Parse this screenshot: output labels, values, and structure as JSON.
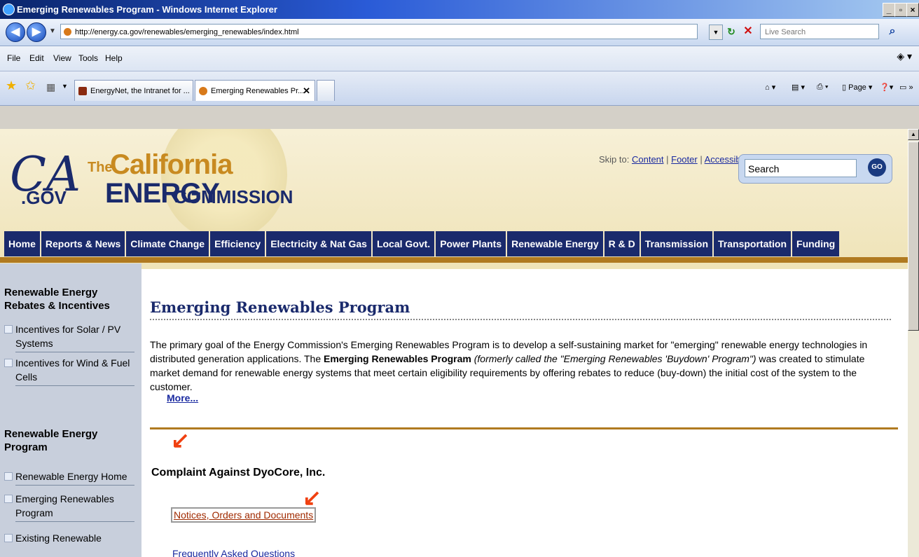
{
  "window": {
    "title": "Emerging Renewables Program - Windows Internet Explorer",
    "minimize": "_",
    "maximize": "▫",
    "close": "×"
  },
  "toolbar": {
    "url": "http://energy.ca.gov/renewables/emerging_renewables/index.html",
    "search_placeholder": "Live Search"
  },
  "menu": {
    "items": [
      "File",
      "Edit",
      "View",
      "Tools",
      "Help"
    ]
  },
  "tabs": [
    {
      "label": "EnergyNet, the Intranet for ..."
    },
    {
      "label": "Emerging Renewables Pr..."
    }
  ],
  "tab_toolbar": {
    "page_label": "Page"
  },
  "site": {
    "logo_ca": "CA",
    "logo_gov": ".GOV",
    "logo_the": "The",
    "logo_california": "California",
    "logo_energy": "ENERGY",
    "logo_commission": "COMMISSION",
    "skip_label": "Skip to:",
    "skip_links": [
      "Content",
      "Footer",
      "Accessibility"
    ],
    "search_value": "Search",
    "search_go": "GO",
    "nav": [
      "Home",
      "Reports & News",
      "Climate Change",
      "Efficiency",
      "Electricity & Nat Gas",
      "Local Govt.",
      "Power Plants",
      "Renewable Energy",
      "R & D",
      "Transmission",
      "Transportation",
      "Funding"
    ]
  },
  "sidebar": {
    "section1_title": "Renewable Energy Rebates & Incentives",
    "section1_items": [
      "Incentives for Solar / PV Systems",
      "Incentives for Wind & Fuel Cells"
    ],
    "section2_title": "Renewable Energy Program",
    "section2_items": [
      "Renewable Energy Home",
      "Emerging Renewables Program",
      "Existing Renewable"
    ]
  },
  "main": {
    "title": "Emerging Renewables Program",
    "para_1": "The primary goal of the Energy Commission's Emerging Renewables Program is to develop a self-sustaining market for \"emerging\" renewable energy technologies in distributed generation applications. The ",
    "para_bold": "Emerging Renewables Program",
    "para_italic": " (formerly called the \"Emerging Renewables 'Buydown' Program\")",
    "para_2": " was created to stimulate market demand for renewable energy systems that meet certain eligibility requirements by offering rebates to reduce (buy-down) the initial cost of the system to the customer.",
    "more_link": "More...",
    "section_heading": "Complaint Against DyoCore, Inc.",
    "link_notices": "Notices, Orders and Documents",
    "link_faq": "Frequently Asked Questions"
  },
  "colors": {
    "navy": "#1a2a6c",
    "gold": "#b07a20",
    "annotation_arrow": "#f04010"
  }
}
